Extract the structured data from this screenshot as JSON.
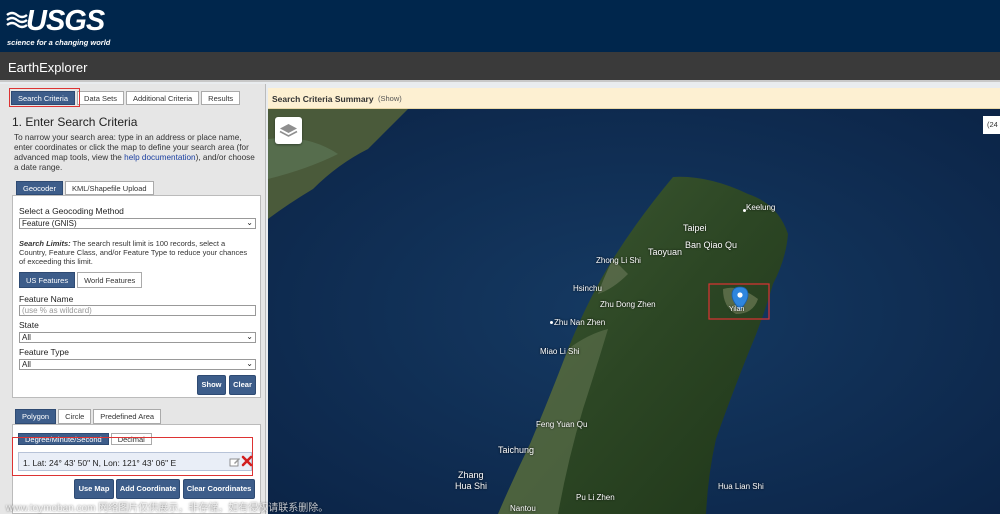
{
  "brand": {
    "name": "USGS",
    "tagline": "science for a changing world"
  },
  "app": {
    "title": "EarthExplorer"
  },
  "tabs": [
    {
      "label": "Search Criteria",
      "active": true
    },
    {
      "label": "Data Sets",
      "active": false
    },
    {
      "label": "Additional Criteria",
      "active": false
    },
    {
      "label": "Results",
      "active": false
    }
  ],
  "step": {
    "title": "1. Enter Search Criteria",
    "intro_before": "To narrow your search area: type in an address or place name, enter coordinates or click the map to define your search area (for advanced map tools, view the ",
    "intro_link": "help documentation",
    "intro_after": "), and/or choose a date range."
  },
  "source_tabs": [
    {
      "label": "Geocoder",
      "active": true
    },
    {
      "label": "KML/Shapefile Upload",
      "active": false
    }
  ],
  "geocoder": {
    "method_label": "Select a Geocoding Method",
    "method_value": "Feature (GNIS)",
    "limits_title": "Search Limits:",
    "limits_text": " The search result limit is 100 records, select a Country, Feature Class, and/or Feature Type to reduce your chances of exceeding this limit.",
    "feature_tabs": [
      {
        "label": "US Features",
        "active": true
      },
      {
        "label": "World Features",
        "active": false
      }
    ],
    "feature_name_label": "Feature Name",
    "feature_name_placeholder": "(use % as wildcard)",
    "state_label": "State",
    "state_value": "All",
    "feature_type_label": "Feature Type",
    "feature_type_value": "All",
    "show_label": "Show",
    "clear_label": "Clear"
  },
  "area_tabs": [
    {
      "label": "Polygon",
      "active": true
    },
    {
      "label": "Circle",
      "active": false
    },
    {
      "label": "Predefined Area",
      "active": false
    }
  ],
  "coord_format_tabs": [
    {
      "label": "Degree/Minute/Second",
      "active": true
    },
    {
      "label": "Decimal",
      "active": false
    }
  ],
  "coordinates": [
    {
      "text": "1.  Lat: 24° 43' 50\" N, Lon: 121° 43' 06\" E"
    }
  ],
  "coord_buttons": {
    "use_map": "Use Map",
    "add": "Add Coordinate",
    "clear": "Clear Coordinates"
  },
  "summary": {
    "title": "Search Criteria Summary",
    "toggle": "(Show)"
  },
  "map": {
    "coords_fragment": "(24",
    "places": [
      {
        "name": "Keelung"
      },
      {
        "name": "Taipei"
      },
      {
        "name": "Ban Qiao Qu"
      },
      {
        "name": "Taoyuan"
      },
      {
        "name": "Zhong Li Shi"
      },
      {
        "name": "Hsinchu"
      },
      {
        "name": "Zhu Dong Zhen"
      },
      {
        "name": "Zhu Nan Zhen"
      },
      {
        "name": "Miao Li Shi"
      },
      {
        "name": "Feng Yuan Qu"
      },
      {
        "name": "Taichung"
      },
      {
        "name": "Zhang"
      },
      {
        "name": "Hua Shi"
      },
      {
        "name": "Pu Li Zhen"
      },
      {
        "name": "Hua Lian Shi"
      },
      {
        "name": "Nantou"
      },
      {
        "name": "Yilan"
      }
    ]
  },
  "watermark": "www.toymoban.com 网络图片仅供展示，非存储，如有侵权请联系删除。",
  "colors": {
    "header": "#00264c",
    "appbar": "#3a3a3a",
    "accent": "#3d5d8a",
    "summary_bg": "#fdf0d2",
    "highlight": "#dd3333"
  }
}
